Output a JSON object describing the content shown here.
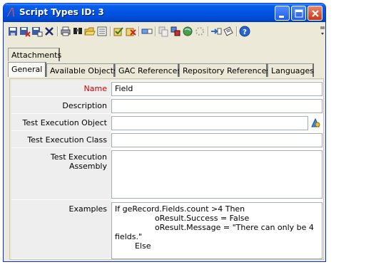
{
  "window": {
    "title": "Script Types ID: 3"
  },
  "toolbar": {
    "icons": [
      "save-icon",
      "save-close-icon",
      "save-new-icon",
      "delete-icon",
      "print-icon",
      "find-icon",
      "open-folder-icon",
      "list-icon",
      "check-icon",
      "tools-icon",
      "split-icon",
      "copy-icon",
      "workflow-icon",
      "globe-icon",
      "settings-icon",
      "link-icon",
      "clipboard-icon",
      "help-icon"
    ]
  },
  "tabs": {
    "row1": [
      {
        "label": "Attachments"
      }
    ],
    "row2": [
      {
        "label": "General",
        "active": true
      },
      {
        "label": "Available Objects"
      },
      {
        "label": "GAC References"
      },
      {
        "label": "Repository References"
      },
      {
        "label": "Languages"
      }
    ]
  },
  "form": {
    "name": {
      "label": "Name",
      "value": "Field"
    },
    "description": {
      "label": "Description",
      "value": ""
    },
    "test_execution_object": {
      "label": "Test Execution Object",
      "value": ""
    },
    "test_execution_class": {
      "label": "Test Execution Class",
      "value": ""
    },
    "test_execution_assembly": {
      "label": "Test Execution Assembly",
      "value": ""
    },
    "examples": {
      "label": "Examples",
      "value": "If geRecord.Fields.count >4 Then\n                oResult.Success = False\n                oResult.Message = \"There can only be 4 fields.\"\n        Else"
    }
  },
  "colors": {
    "title_bar": "#0054e3",
    "required_label": "#cc0000",
    "label_bg": "#eeeeee"
  }
}
